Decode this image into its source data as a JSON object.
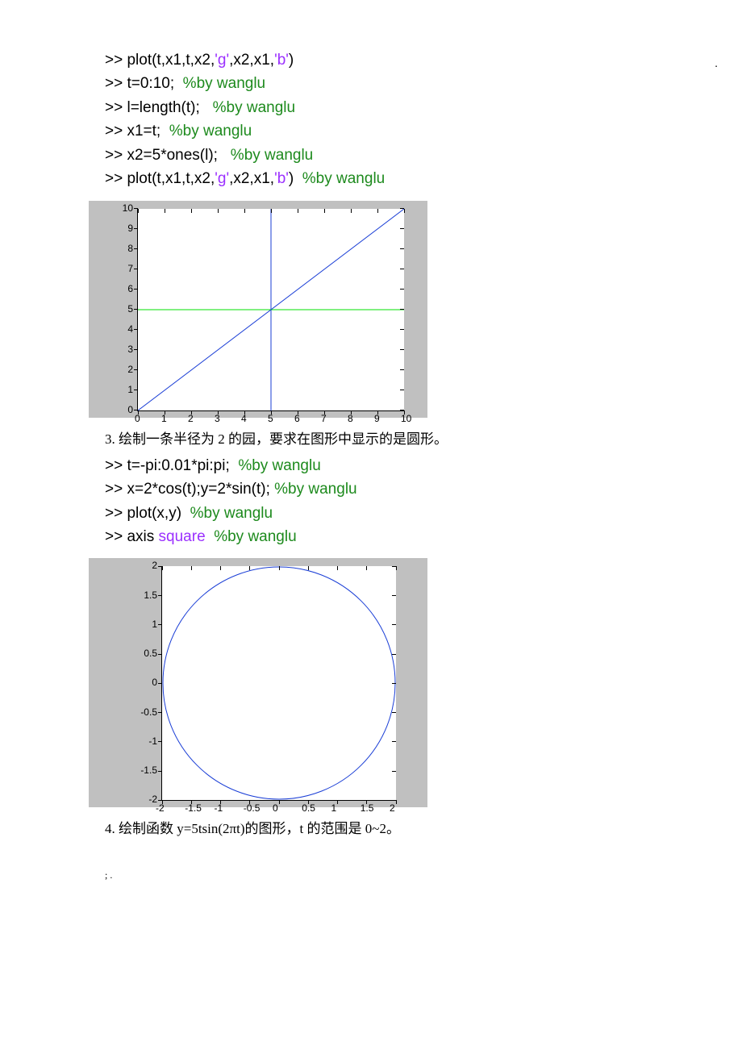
{
  "dot_tr": ".",
  "code1": {
    "l1a": ">> plot(t,x1,t,x2,",
    "l1b": "'g'",
    "l1c": ",x2,x1,",
    "l1d": "'b'",
    "l1e": ")",
    "l2a": ">> t=0:10;  ",
    "l2b": "%by wanglu",
    "l3a": ">> l=length(t);   ",
    "l3b": "%by wanglu",
    "l4a": ">> x1=t;  ",
    "l4b": "%by wanglu",
    "l5a": ">> x2=5*ones(l);   ",
    "l5b": "%by wanglu",
    "l6a": ">> plot(t,x1,t,x2,",
    "l6b": "'g'",
    "l6c": ",x2,x1,",
    "l6d": "'b'",
    "l6e": ")  ",
    "l6f": "%by wanglu"
  },
  "text3": "3.  绘制一条半径为 2 的园，要求在图形中显示的是圆形。",
  "code2": {
    "l1a": ">> t=-pi:0.01*pi:pi;  ",
    "l1b": "%by wanglu",
    "l2a": ">> x=2*cos(t);y=2*sin(t); ",
    "l2b": "%by wanglu",
    "l3a": ">> plot(x,y)  ",
    "l3b": "%by wanglu",
    "l4a": ">> axis ",
    "l4b": "square  ",
    "l4c": "%by wanglu"
  },
  "text4": "4.  绘制函数 y=5tsin(2πt)的图形，t 的范围是 0~2。",
  "footer": ";   .",
  "chart_data": [
    {
      "type": "line",
      "title": "",
      "xlabel": "",
      "ylabel": "",
      "xlim": [
        0,
        10
      ],
      "ylim": [
        0,
        10
      ],
      "xticks": [
        0,
        1,
        2,
        3,
        4,
        5,
        6,
        7,
        8,
        9,
        10
      ],
      "yticks": [
        0,
        1,
        2,
        3,
        4,
        5,
        6,
        7,
        8,
        9,
        10
      ],
      "series": [
        {
          "name": "x1 blue diag",
          "color": "blue",
          "x": [
            0,
            10
          ],
          "y": [
            0,
            10
          ]
        },
        {
          "name": "x2 green h",
          "color": "green",
          "x": [
            0,
            10
          ],
          "y": [
            5,
            5
          ]
        },
        {
          "name": "blue v",
          "color": "blue",
          "x": [
            5,
            5
          ],
          "y": [
            0,
            10
          ]
        }
      ]
    },
    {
      "type": "line",
      "title": "",
      "xlabel": "",
      "ylabel": "",
      "xlim": [
        -2,
        2
      ],
      "ylim": [
        -2,
        2
      ],
      "xticks": [
        -2,
        -1.5,
        -1,
        -0.5,
        0,
        0.5,
        1,
        1.5,
        2
      ],
      "yticks": [
        -2,
        -1.5,
        -1,
        -0.5,
        0,
        0.5,
        1,
        1.5,
        2
      ],
      "series": [
        {
          "name": "circle r=2",
          "color": "blue",
          "shape": "circle",
          "cx": 0,
          "cy": 0,
          "r": 2
        }
      ]
    }
  ],
  "fig1_xt": [
    "0",
    "1",
    "2",
    "3",
    "4",
    "5",
    "6",
    "7",
    "8",
    "9",
    "10"
  ],
  "fig1_yt": [
    "0",
    "1",
    "2",
    "3",
    "4",
    "5",
    "6",
    "7",
    "8",
    "9",
    "10"
  ],
  "fig2_xt": [
    "-2",
    "-1.5",
    "-1",
    "-0.5",
    "0",
    "0.5",
    "1",
    "1.5",
    "2"
  ],
  "fig2_yt": [
    "-2",
    "-1.5",
    "-1",
    "-0.5",
    "0",
    "0.5",
    "1",
    "1.5",
    "2"
  ]
}
